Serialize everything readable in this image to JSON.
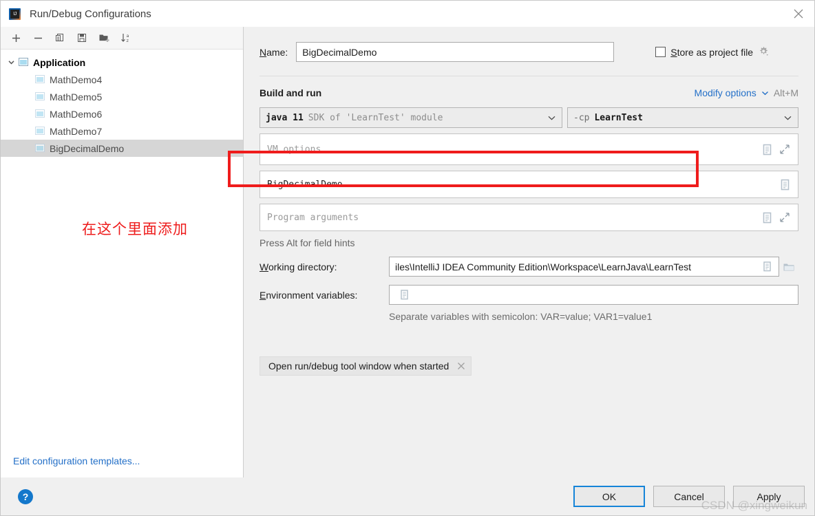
{
  "window": {
    "title": "Run/Debug Configurations",
    "close_icon": "close-icon",
    "logo": "intellij-idea-logo"
  },
  "sidebar": {
    "toolbar": [
      {
        "name": "add-configuration-button",
        "icon": "plus-icon"
      },
      {
        "name": "remove-configuration-button",
        "icon": "minus-icon"
      },
      {
        "name": "copy-configuration-button",
        "icon": "copy-icon"
      },
      {
        "name": "save-configuration-button",
        "icon": "save-icon"
      },
      {
        "name": "new-folder-button",
        "icon": "new-folder-icon"
      },
      {
        "name": "sort-configurations-button",
        "icon": "sort-alphabetical-icon"
      }
    ],
    "tree": {
      "group_label": "Application",
      "items": [
        {
          "label": "MathDemo4",
          "selected": false
        },
        {
          "label": "MathDemo5",
          "selected": false
        },
        {
          "label": "MathDemo6",
          "selected": false
        },
        {
          "label": "MathDemo7",
          "selected": false
        },
        {
          "label": "BigDecimalDemo",
          "selected": true
        }
      ]
    },
    "edit_templates_link": "Edit configuration templates..."
  },
  "annotation": {
    "text": "在这个里面添加",
    "color": "#ef1c1c"
  },
  "main": {
    "name_label": "Name:",
    "name_mnemonic": "N",
    "name_value": "BigDecimalDemo",
    "store_as_project_file": {
      "label": "Store as project file",
      "mnemonic": "S",
      "checked": false,
      "gear_icon": "gear-icon"
    },
    "build_and_run": {
      "title": "Build and run",
      "modify_options_link": "Modify options",
      "modify_options_shortcut": "Alt+M",
      "jdk_combo": {
        "prefix": "java 11",
        "suffix": "SDK of 'LearnTest' module"
      },
      "classpath_combo": {
        "prefix": "-cp",
        "value": "LearnTest"
      },
      "vm_options": {
        "placeholder": "VM options",
        "value": "",
        "expand_icon": "expand-arrows-icon",
        "list_icon": "document-list-icon"
      },
      "main_class": {
        "value": "BigDecimalDemo",
        "list_icon": "document-list-icon"
      },
      "program_arguments": {
        "placeholder": "Program arguments",
        "value": "",
        "expand_icon": "expand-arrows-icon",
        "list_icon": "document-list-icon"
      },
      "field_hint": "Press Alt for field hints",
      "working_directory": {
        "label": "Working directory:",
        "mnemonic": "W",
        "value": "iles\\IntelliJ IDEA Community Edition\\Workspace\\LearnJava\\LearnTest",
        "list_icon": "document-list-icon",
        "browse_icon": "folder-icon"
      },
      "environment_variables": {
        "label": "Environment variables:",
        "mnemonic": "E",
        "value": "",
        "list_icon": "document-list-icon",
        "hint": "Separate variables with semicolon: VAR=value; VAR1=value1"
      },
      "option_chip": {
        "label": "Open run/debug tool window when started",
        "remove_icon": "close-icon"
      }
    }
  },
  "footer": {
    "help_label": "?",
    "buttons": [
      {
        "label": "OK",
        "primary": true
      },
      {
        "label": "Cancel",
        "primary": false
      },
      {
        "label": "Apply",
        "primary": false
      }
    ],
    "watermark": "CSDN @xingweikun"
  }
}
